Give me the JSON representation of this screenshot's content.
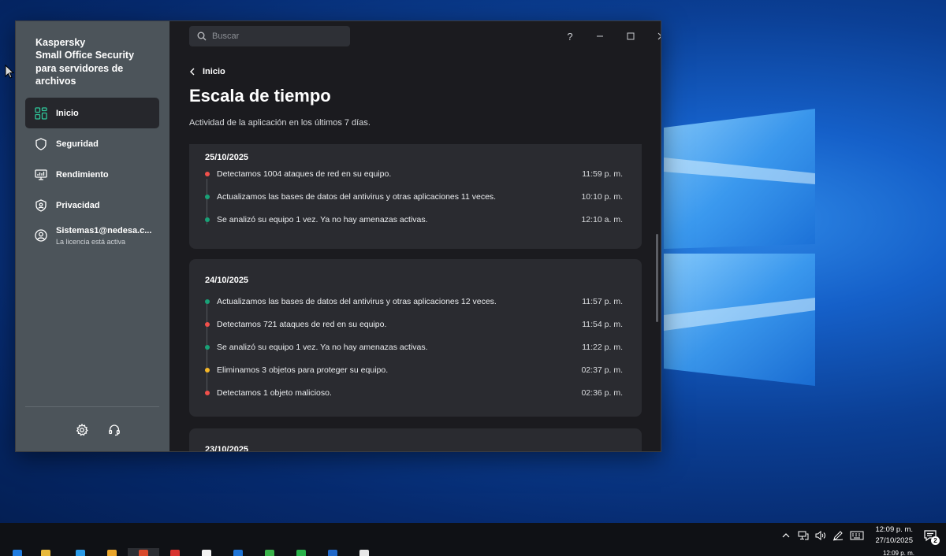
{
  "app": {
    "brand_line1": "Kaspersky",
    "brand_line2": "Small Office Security",
    "brand_line3": "para servidores de",
    "brand_line4": "archivos"
  },
  "sidebar": {
    "items": [
      {
        "label": "Inicio",
        "icon": "dashboard-icon",
        "active": true
      },
      {
        "label": "Seguridad",
        "icon": "shield-icon",
        "active": false
      },
      {
        "label": "Rendimiento",
        "icon": "monitor-performance-icon",
        "active": false
      },
      {
        "label": "Privacidad",
        "icon": "privacy-icon",
        "active": false
      }
    ],
    "account": {
      "name": "Sistemas1@nedesa.c...",
      "license": "La licencia está activa"
    },
    "footer_icons": [
      "gear-icon",
      "support-headset-icon"
    ]
  },
  "search": {
    "placeholder": "Buscar"
  },
  "window_controls": {
    "help": "?"
  },
  "header": {
    "back_label": "Inicio",
    "title": "Escala de tiempo",
    "subtitle": "Actividad de la aplicación en los últimos 7 días."
  },
  "colors": {
    "accent_green": "#19a177",
    "alert_red": "#f0504b",
    "warning_yellow": "#f5b728",
    "sidebar_bg": "#4c545a",
    "main_bg": "#1b1b1f",
    "card_bg": "#2a2b30"
  },
  "timeline": [
    {
      "date": "25/10/2025",
      "events": [
        {
          "text": "Detectamos 1004 ataques de red en su equipo.",
          "time": "11:59 p. m.",
          "status": "red"
        },
        {
          "text": "Actualizamos las bases de datos del antivirus y otras aplicaciones 11 veces.",
          "time": "10:10 p. m.",
          "status": "green"
        },
        {
          "text": "Se analizó su equipo 1 vez. Ya no hay amenazas activas.",
          "time": "12:10 a. m.",
          "status": "green"
        }
      ]
    },
    {
      "date": "24/10/2025",
      "events": [
        {
          "text": "Actualizamos las bases de datos del antivirus y otras aplicaciones 12 veces.",
          "time": "11:57 p. m.",
          "status": "green"
        },
        {
          "text": "Detectamos 721 ataques de red en su equipo.",
          "time": "11:54 p. m.",
          "status": "red"
        },
        {
          "text": "Se analizó su equipo 1 vez. Ya no hay amenazas activas.",
          "time": "11:22 p. m.",
          "status": "green"
        },
        {
          "text": "Eliminamos 3 objetos para proteger su equipo.",
          "time": "02:37 p. m.",
          "status": "yellow"
        },
        {
          "text": "Detectamos 1 objeto malicioso.",
          "time": "02:36 p. m.",
          "status": "red"
        }
      ]
    },
    {
      "date": "23/10/2025",
      "events": []
    }
  ],
  "taskbar": {
    "time": "12:09 p. m.",
    "date": "27/10/2025",
    "notification_count": "2",
    "time_peek": "12:09 p. m."
  }
}
